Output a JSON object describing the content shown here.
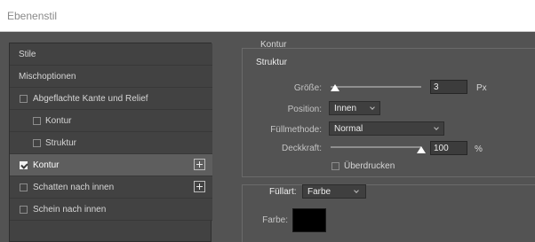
{
  "window": {
    "title": "Ebenenstil"
  },
  "sidebar": {
    "items": [
      {
        "label": "Stile",
        "has_checkbox": false,
        "checked": false,
        "indented": false,
        "has_add": false,
        "active": false
      },
      {
        "label": "Mischoptionen",
        "has_checkbox": false,
        "checked": false,
        "indented": false,
        "has_add": false,
        "active": false
      },
      {
        "label": "Abgeflachte Kante und Relief",
        "has_checkbox": true,
        "checked": false,
        "indented": false,
        "has_add": false,
        "active": false
      },
      {
        "label": "Kontur",
        "has_checkbox": true,
        "checked": false,
        "indented": true,
        "has_add": false,
        "active": false
      },
      {
        "label": "Struktur",
        "has_checkbox": true,
        "checked": false,
        "indented": true,
        "has_add": false,
        "active": false
      },
      {
        "label": "Kontur",
        "has_checkbox": true,
        "checked": true,
        "indented": false,
        "has_add": true,
        "active": true
      },
      {
        "label": "Schatten nach innen",
        "has_checkbox": true,
        "checked": false,
        "indented": false,
        "has_add": true,
        "active": false
      },
      {
        "label": "Schein nach innen",
        "has_checkbox": true,
        "checked": false,
        "indented": false,
        "has_add": false,
        "active": false
      }
    ]
  },
  "panel": {
    "section_title": "Kontur",
    "structure": {
      "title": "Struktur",
      "size": {
        "label": "Größe:",
        "value": "3",
        "unit": "Px",
        "slider_fraction": 0.02
      },
      "position": {
        "label": "Position:",
        "value": "Innen"
      },
      "blend_mode": {
        "label": "Füllmethode:",
        "value": "Normal"
      },
      "opacity": {
        "label": "Deckkraft:",
        "value": "100",
        "unit": "%",
        "slider_fraction": 1.0
      },
      "overprint": {
        "label": "Überdrucken",
        "checked": false
      }
    },
    "fill": {
      "label": "Füllart:",
      "value": "Farbe",
      "color_label": "Farbe:",
      "color": "#000000"
    }
  }
}
